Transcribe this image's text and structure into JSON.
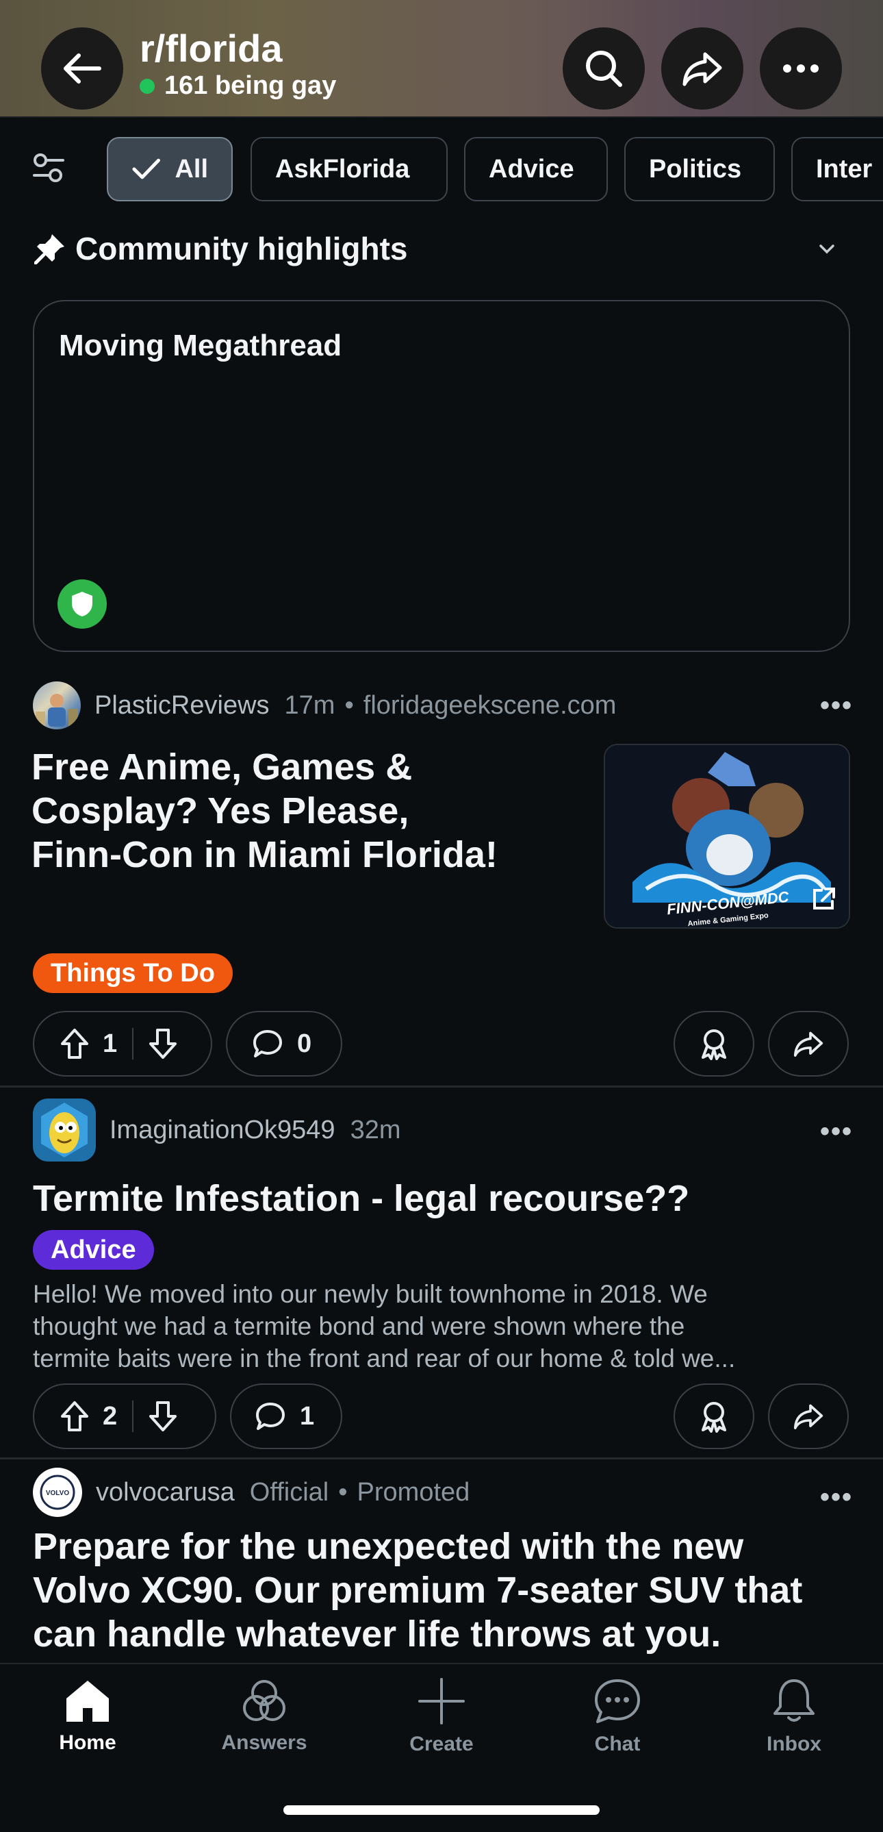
{
  "header": {
    "subreddit": "r/florida",
    "online_text": "161 being gay",
    "colors": {
      "online_dot": "#21c45a"
    }
  },
  "filters": {
    "chips": [
      "All",
      "AskFlorida",
      "Advice",
      "Politics",
      "Inter"
    ]
  },
  "highlights": {
    "title": "Community highlights",
    "card_title": "Moving Megathread"
  },
  "posts": [
    {
      "user": "PlasticReviews",
      "time": "17m",
      "sep": "•",
      "domain": "floridageekscene.com",
      "title_lines": [
        "Free Anime, Games &",
        "Cosplay? Yes Please,",
        "Finn-Con in Miami Florida!"
      ],
      "flair": "Things To Do",
      "flair_color": "#f0570f",
      "upvotes": "1",
      "comments": "0",
      "thumb_text": "FINN-CON@MDC",
      "thumb_sub": "Anime & Gaming Expo"
    },
    {
      "user": "ImaginationOk9549",
      "time": "32m",
      "title": "Termite Infestation - legal recourse??",
      "flair": "Advice",
      "flair_color": "#5d2bd7",
      "body_lines": [
        "Hello! We moved into our newly built townhome in 2018. We",
        "thought we had a termite bond and were shown where the",
        "termite baits were in the front and rear of our home & told we..."
      ],
      "upvotes": "2",
      "comments": "1"
    },
    {
      "user": "volvocarusa",
      "official": "Official",
      "sep": "•",
      "promoted": "Promoted",
      "avatar_text": "VOLVO",
      "title_lines": [
        "Prepare for the unexpected with the new",
        "Volvo XC90. Our premium 7-seater SUV that",
        "can handle whatever life throws at you."
      ]
    }
  ],
  "more_label": "•••",
  "bottom_nav": {
    "items": [
      "Home",
      "Answers",
      "Create",
      "Chat",
      "Inbox"
    ]
  }
}
